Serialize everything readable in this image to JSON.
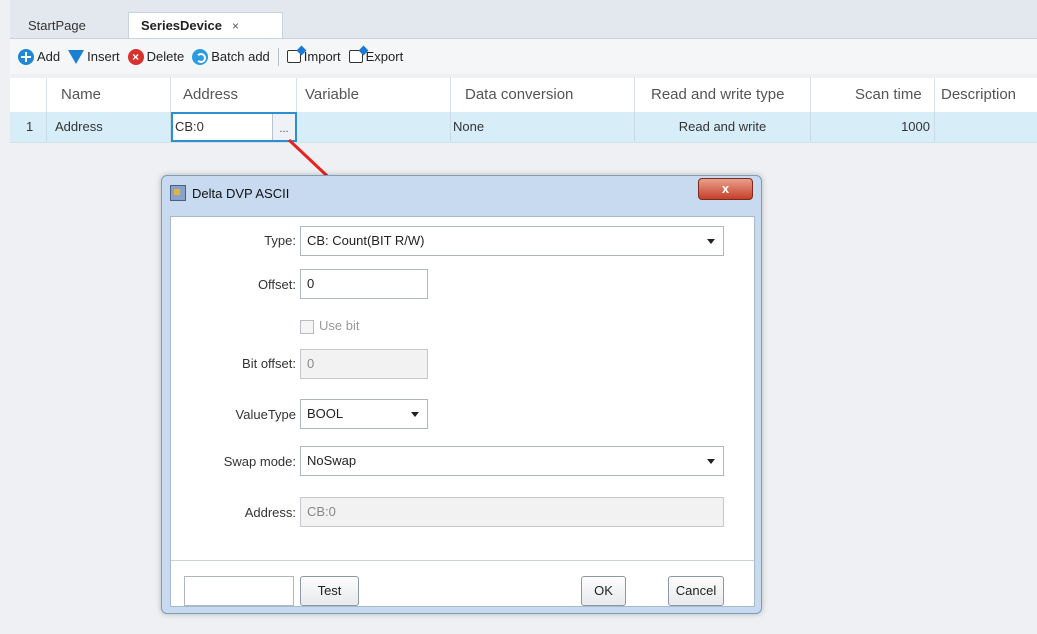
{
  "tabs": [
    {
      "label": "StartPage"
    },
    {
      "label": "SeriesDevice",
      "close": "×"
    }
  ],
  "toolbar": {
    "add": "Add",
    "insert": "Insert",
    "delete": "Delete",
    "batch_add": "Batch add",
    "import": "Import",
    "export": "Export"
  },
  "grid": {
    "columns": [
      "Name",
      "Address",
      "Variable",
      "Data conversion",
      "Read and write type",
      "Scan time",
      "Description"
    ],
    "rows": [
      {
        "index": "1",
        "name": "Address",
        "address": "CB:0",
        "ellipsis": "...",
        "variable": "",
        "data_conversion": "None",
        "rw_type": "Read and write",
        "scan_time": "1000",
        "description": ""
      }
    ]
  },
  "dialog": {
    "title": "Delta DVP ASCII",
    "close": "x",
    "type_label": "Type:",
    "type_value": "CB: Count(BIT R/W)",
    "offset_label": "Offset:",
    "offset_value": "0",
    "use_bit_label": "Use bit",
    "use_bit_checked": false,
    "bit_offset_label": "Bit offset:",
    "bit_offset_value": "0",
    "value_type_label": "ValueType",
    "value_type_value": "BOOL",
    "swap_mode_label": "Swap mode:",
    "swap_mode_value": "NoSwap",
    "address_label": "Address:",
    "address_value": "CB:0",
    "test_input_value": "",
    "test_button": "Test",
    "ok_button": "OK",
    "cancel_button": "Cancel"
  },
  "colors": {
    "accent": "#2d8fd0",
    "selected_row": "#d7eef9",
    "arrow": "#e8231f"
  }
}
